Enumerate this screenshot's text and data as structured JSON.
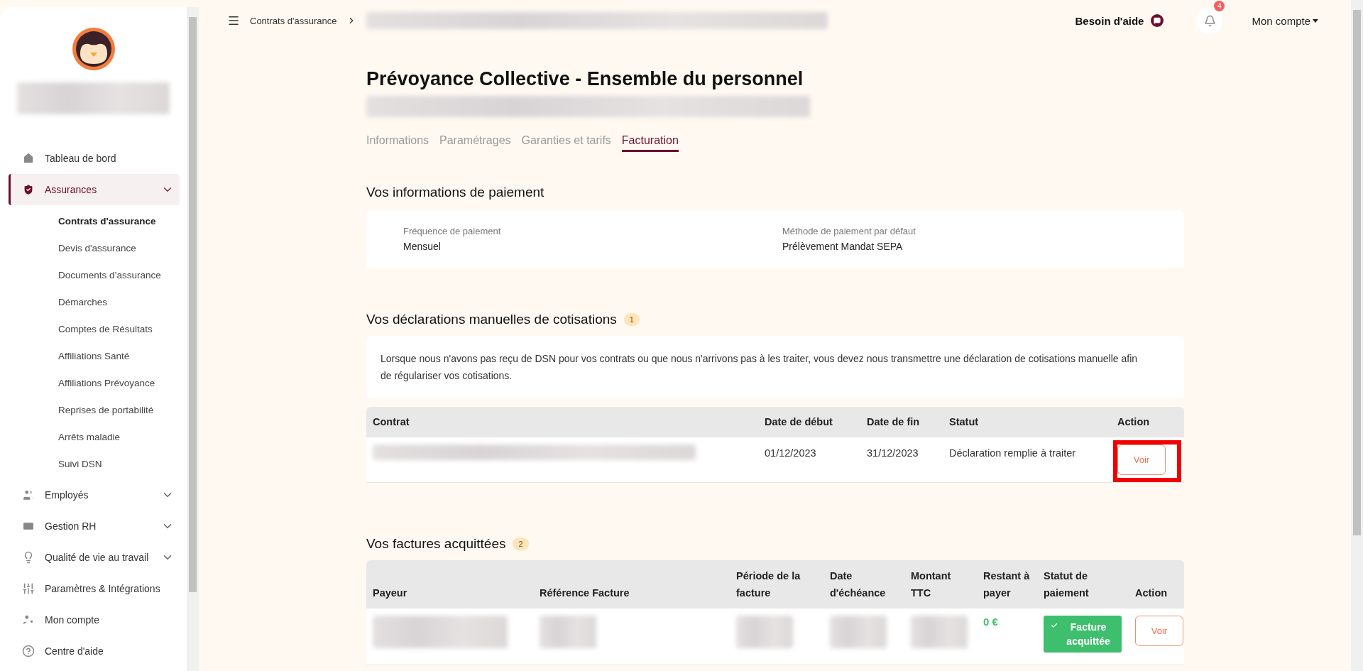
{
  "topbar": {
    "breadcrumb": "Contrats d'assurance",
    "help": "Besoin d'aide",
    "notifications": "4",
    "account": "Mon compte"
  },
  "sidebar": {
    "items": [
      {
        "label": "Tableau de bord",
        "selected": false
      },
      {
        "label": "Assurances",
        "selected": true,
        "expanded": true,
        "children": [
          {
            "label": "Contrats d'assurance",
            "selected": true
          },
          {
            "label": "Devis d'assurance",
            "selected": false
          },
          {
            "label": "Documents d’assurance",
            "selected": false
          },
          {
            "label": "Démarches",
            "selected": false
          },
          {
            "label": "Comptes de Résultats",
            "selected": false
          },
          {
            "label": "Affiliations Santé",
            "selected": false
          },
          {
            "label": "Affiliations Prévoyance",
            "selected": false
          },
          {
            "label": "Reprises de portabilité",
            "selected": false
          },
          {
            "label": "Arrêts maladie",
            "selected": false
          },
          {
            "label": "Suivi DSN",
            "selected": false
          }
        ]
      },
      {
        "label": "Employés",
        "selected": false,
        "expanded": false
      },
      {
        "label": "Gestion RH",
        "selected": false,
        "expanded": false
      },
      {
        "label": "Qualité de vie au travail",
        "selected": false,
        "expanded": false
      },
      {
        "label": "Paramètres & Intégrations",
        "selected": false
      },
      {
        "label": "Mon compte",
        "selected": false
      },
      {
        "label": "Centre d'aide",
        "selected": false
      }
    ]
  },
  "page": {
    "title": "Prévoyance Collective - Ensemble du personnel"
  },
  "tabs": [
    {
      "label": "Informations",
      "selected": false
    },
    {
      "label": "Paramétrages",
      "selected": false
    },
    {
      "label": "Garanties et tarifs",
      "selected": false
    },
    {
      "label": "Facturation",
      "selected": true
    }
  ],
  "payment": {
    "title": "Vos informations de paiement",
    "fields": [
      {
        "label": "Fréquence de paiement",
        "value": "Mensuel"
      },
      {
        "label": "Méthode de paiement par défaut",
        "value": "Prélèvement Mandat SEPA"
      }
    ]
  },
  "declarations": {
    "title": "Vos déclarations manuelles de cotisations",
    "count": "1",
    "description": "Lorsque nous n'avons pas reçu de DSN pour vos contrats ou que nous n'arrivons pas à les traiter, vous devez nous transmettre une déclaration de cotisations manuelle afin de régulariser vos cotisations.",
    "columns": [
      "Contrat",
      "Date de début",
      "Date de fin",
      "Statut",
      "Action"
    ],
    "rows": [
      {
        "cells": [
          {
            "kind": "blurred"
          },
          {
            "kind": "text",
            "text": "01/12/2023"
          },
          {
            "kind": "text",
            "text": "31/12/2023"
          },
          {
            "kind": "text",
            "text": "Déclaration remplie à traiter"
          }
        ],
        "action": "Voir",
        "highlighted": true
      }
    ]
  },
  "invoices": {
    "title": "Vos factures acquittées",
    "count": "2",
    "columns": [
      "Payeur",
      "Référence Facture",
      "Période de la facture",
      "Date d'échéance",
      "Montant TTC",
      "Restant à payer",
      "Statut de paiement",
      "Action"
    ],
    "rows": [
      {
        "cells": [
          {
            "kind": "blurred"
          },
          {
            "kind": "blurred"
          },
          {
            "kind": "blurred"
          },
          {
            "kind": "blurred"
          },
          {
            "kind": "blurred"
          },
          {
            "kind": "amount",
            "text": "0 €"
          },
          {
            "kind": "status",
            "text": "Facture acquittée",
            "paid": true
          }
        ],
        "action": "Voir",
        "highlighted": false
      }
    ]
  }
}
